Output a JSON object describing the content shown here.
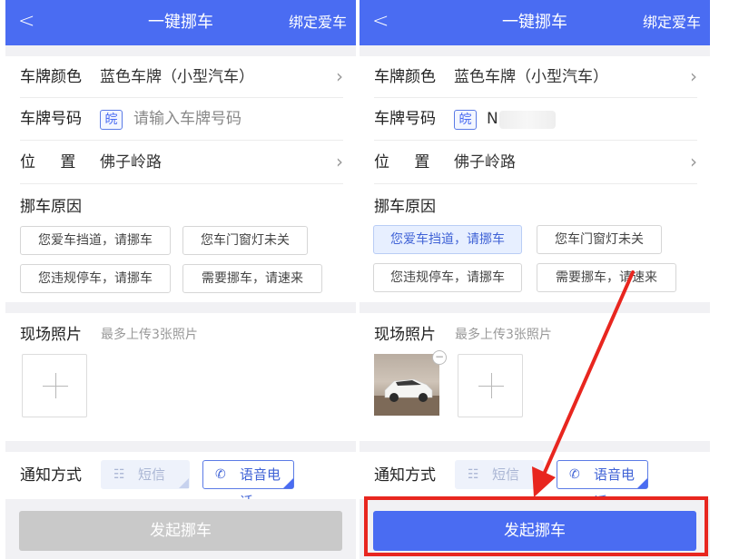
{
  "screens": [
    {
      "nav": {
        "back_glyph": "<",
        "title": "一键挪车",
        "bind_car": "绑定爱车"
      },
      "plate_color": {
        "label": "车牌颜色",
        "value": "蓝色车牌（小型汽车）"
      },
      "plate_number": {
        "label": "车牌号码",
        "province": "皖",
        "placeholder": "请输入车牌号码"
      },
      "location": {
        "label": "位 置",
        "value": "佛子岭路"
      },
      "reason": {
        "label": "挪车原因",
        "chips": [
          "您爱车挡道，请挪车",
          "您车门窗灯未关",
          "您违规停车，请挪车",
          "需要挪车，请速来"
        ]
      },
      "photos": {
        "label": "现场照片",
        "hint": "最多上传3张照片"
      },
      "notify": {
        "label": "通知方式",
        "sms": "短信",
        "voice": "语音电话"
      },
      "submit": {
        "label": "发起挪车",
        "state": "disabled"
      }
    },
    {
      "nav": {
        "back_glyph": "<",
        "title": "一键挪车",
        "bind_car": "绑定爱车"
      },
      "plate_color": {
        "label": "车牌颜色",
        "value": "蓝色车牌（小型汽车）"
      },
      "plate_number": {
        "label": "车牌号码",
        "province": "皖",
        "value": "N"
      },
      "location": {
        "label": "位 置",
        "value": "佛子岭路"
      },
      "reason": {
        "label": "挪车原因",
        "chips": [
          "您爱车挡道，请挪车",
          "您车门窗灯未关",
          "您违规停车，请挪车",
          "需要挪车，请速来"
        ],
        "selected": "您爱车挡道，请挪车"
      },
      "photos": {
        "label": "现场照片",
        "hint": "最多上传3张照片",
        "uploaded_count": 1
      },
      "notify": {
        "label": "通知方式",
        "sms": "短信",
        "voice": "语音电话"
      },
      "submit": {
        "label": "发起挪车",
        "state": "active"
      }
    }
  ],
  "icons": {
    "back": "chevron-left-icon",
    "chevron": "chevron-right-icon",
    "plus": "plus-icon",
    "remove": "minus-circle-icon",
    "sms": "message-icon",
    "phone": "phone-icon"
  },
  "colors": {
    "brand": "#4a6cf2",
    "disabled": "#c9c9c9",
    "annotation": "#e8261f",
    "selected_chip_bg": "#e7efff"
  }
}
